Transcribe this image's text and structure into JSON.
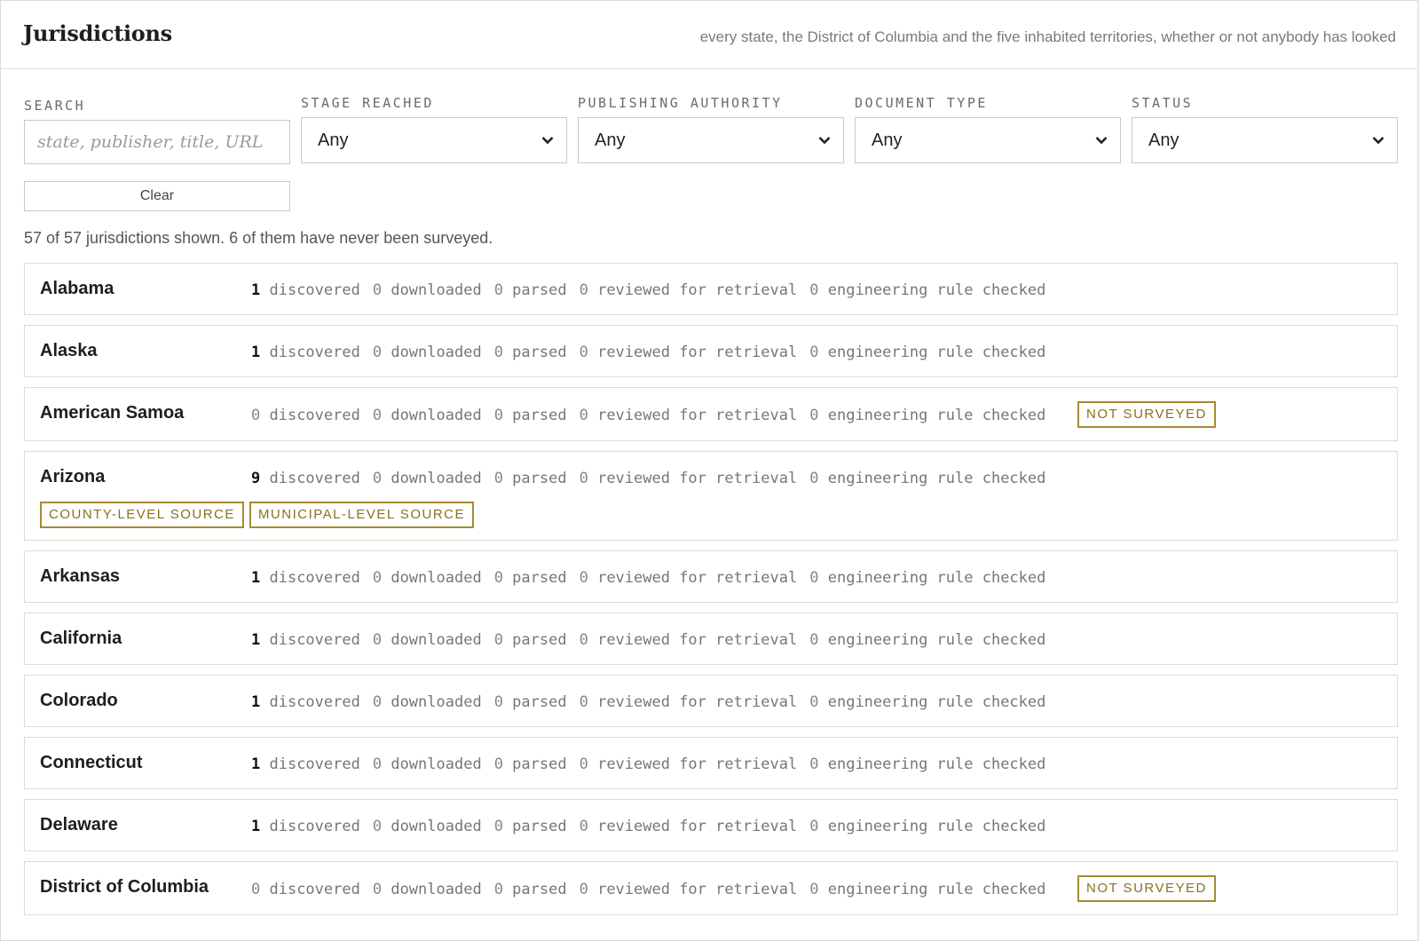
{
  "header": {
    "title": "Jurisdictions",
    "subtitle": "every state, the District of Columbia and the five inhabited territories, whether or not anybody has looked"
  },
  "filters": {
    "search": {
      "label": "SEARCH",
      "placeholder": "state, publisher, title, URL",
      "value": ""
    },
    "stage": {
      "label": "STAGE REACHED",
      "selected": "Any"
    },
    "authority": {
      "label": "PUBLISHING AUTHORITY",
      "selected": "Any"
    },
    "doctype": {
      "label": "DOCUMENT TYPE",
      "selected": "Any"
    },
    "status": {
      "label": "STATUS",
      "selected": "Any"
    },
    "clear_label": "Clear"
  },
  "summary": "57 of 57 jurisdictions shown. 6 of them have never been surveyed.",
  "stat_labels": [
    "discovered",
    "downloaded",
    "parsed",
    "reviewed for retrieval",
    "engineering rule checked"
  ],
  "colors": {
    "badge_border": "#a68a34",
    "badge_text": "#8a6f22"
  },
  "jurisdictions": [
    {
      "name": "Alabama",
      "counts": [
        1,
        0,
        0,
        0,
        0
      ],
      "badges": []
    },
    {
      "name": "Alaska",
      "counts": [
        1,
        0,
        0,
        0,
        0
      ],
      "badges": []
    },
    {
      "name": "American Samoa",
      "counts": [
        0,
        0,
        0,
        0,
        0
      ],
      "badges": [
        "NOT SURVEYED"
      ]
    },
    {
      "name": "Arizona",
      "counts": [
        9,
        0,
        0,
        0,
        0
      ],
      "badges": [
        "COUNTY-LEVEL SOURCE",
        "MUNICIPAL-LEVEL SOURCE"
      ]
    },
    {
      "name": "Arkansas",
      "counts": [
        1,
        0,
        0,
        0,
        0
      ],
      "badges": []
    },
    {
      "name": "California",
      "counts": [
        1,
        0,
        0,
        0,
        0
      ],
      "badges": []
    },
    {
      "name": "Colorado",
      "counts": [
        1,
        0,
        0,
        0,
        0
      ],
      "badges": []
    },
    {
      "name": "Connecticut",
      "counts": [
        1,
        0,
        0,
        0,
        0
      ],
      "badges": []
    },
    {
      "name": "Delaware",
      "counts": [
        1,
        0,
        0,
        0,
        0
      ],
      "badges": []
    },
    {
      "name": "District of Columbia",
      "counts": [
        0,
        0,
        0,
        0,
        0
      ],
      "badges": [
        "NOT SURVEYED"
      ]
    }
  ]
}
